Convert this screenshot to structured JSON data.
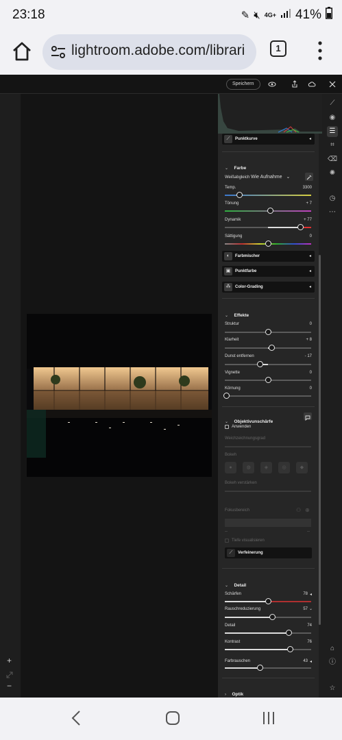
{
  "status_bar": {
    "time": "23:18",
    "network": "4G+",
    "battery": "41%",
    "icons": [
      "link-icon",
      "mute-icon",
      "signal-icon",
      "battery-icon"
    ]
  },
  "browser": {
    "url": "lightroom.adobe.com/librari",
    "tab_count": "1"
  },
  "toolbar": {
    "save_label": "Speichern"
  },
  "panel": {
    "punktkurve_label": "Punktkurve",
    "farbe": {
      "title": "Farbe",
      "wb_label": "Weißabgleich",
      "wb_value": "Wie Aufnahme",
      "sliders": [
        {
          "label": "Temp.",
          "value": "3300",
          "position": 0.17
        },
        {
          "label": "Tönung",
          "value": "+ 7",
          "position": 0.53
        },
        {
          "label": "Dynamik",
          "value": "+ 77",
          "position": 0.88
        },
        {
          "label": "Sättigung",
          "value": "0",
          "position": 0.5
        }
      ]
    },
    "tools": {
      "farbmischer": "Farbmischer",
      "punktfarbe": "Punktfarbe",
      "color_grading": "Color-Grading"
    },
    "effekte": {
      "title": "Effekte",
      "sliders": [
        {
          "label": "Struktur",
          "value": "0",
          "position": 0.5
        },
        {
          "label": "Klarheit",
          "value": "+ 8",
          "position": 0.54
        },
        {
          "label": "Dunst entfernen",
          "value": "- 17",
          "position": 0.41
        },
        {
          "label": "Vignette",
          "value": "0",
          "position": 0.5
        },
        {
          "label": "Körnung",
          "value": "0",
          "position": 0.0
        }
      ]
    },
    "objektiv": {
      "title": "Objektivunschärfe",
      "apply_label": "Anwenden",
      "blur_amount_label": "Weichzeichnungsgrad",
      "bokeh_label": "Bokeh",
      "bokeh_boost_label": "Bokeh verstärken",
      "focus_label": "Fokusbereich",
      "focus_min": "--",
      "focus_max": "--",
      "visualize_label": "Tiefe visualisieren",
      "refine_label": "Verfeinerung"
    },
    "detail": {
      "title": "Detail",
      "sliders": [
        {
          "label": "Schärfen",
          "value": "78",
          "position": 0.5
        },
        {
          "label": "Rauschreduzierung",
          "value": "57",
          "position": 0.55
        },
        {
          "label": "Detail",
          "value": "74",
          "position": 0.74
        },
        {
          "label": "Kontrast",
          "value": "76",
          "position": 0.76
        },
        {
          "label": "Farbrauschen",
          "value": "43",
          "position": 0.41
        }
      ]
    },
    "optik_title": "Optik"
  },
  "zoom_controls": {
    "plus": "+",
    "minus": "−"
  }
}
